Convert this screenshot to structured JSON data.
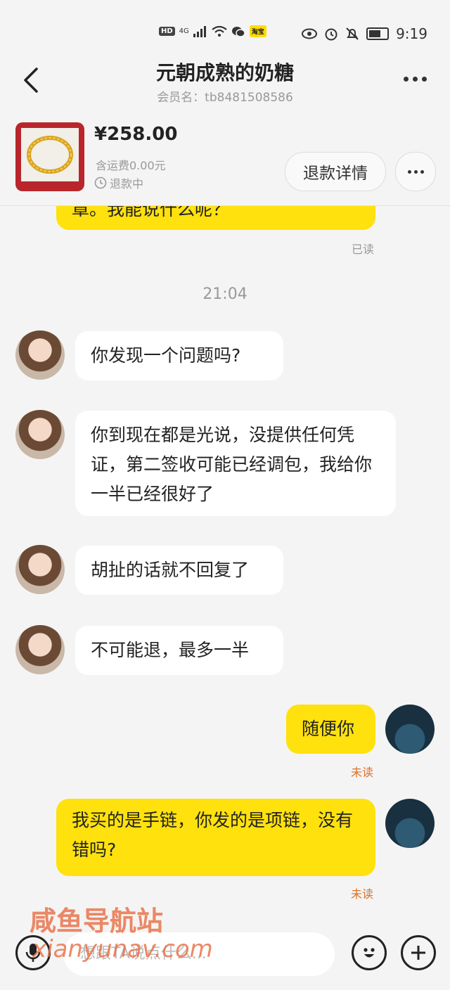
{
  "status_bar": {
    "left_badges": [
      "HD",
      "4G",
      "淘宝"
    ],
    "time": "9:19"
  },
  "header": {
    "title": "元朝成熟的奶糖",
    "member_label": "会员名：tb8481508586"
  },
  "product": {
    "price": "¥258.00",
    "shipping": "含运费0.00元",
    "status": "退款中",
    "refund_button": "退款详情"
  },
  "messages": {
    "partial_out": "章。我能说什么呢？",
    "partial_out_read": "已读",
    "time_divider": "21:04",
    "in_1": "你发现一个问题吗?",
    "in_2": "你到现在都是光说，没提供任何凭证，第二签收可能已经调包，我给你一半已经很好了",
    "in_3": "胡扯的话就不回复了",
    "in_4": "不可能退，最多一半",
    "out_1": "随便你",
    "out_1_status": "未读",
    "out_2": "我买的是手链，你发的是项链，没有错吗?",
    "out_2_status": "未读"
  },
  "input_bar": {
    "placeholder": "想跟TA说点什么..."
  },
  "watermark": {
    "line1": "咸鱼导航站",
    "line2": "xianyunav.com"
  },
  "colors": {
    "accent_yellow": "#ffe10d",
    "unread_orange": "#d9712a",
    "background": "#f4f4f4"
  }
}
